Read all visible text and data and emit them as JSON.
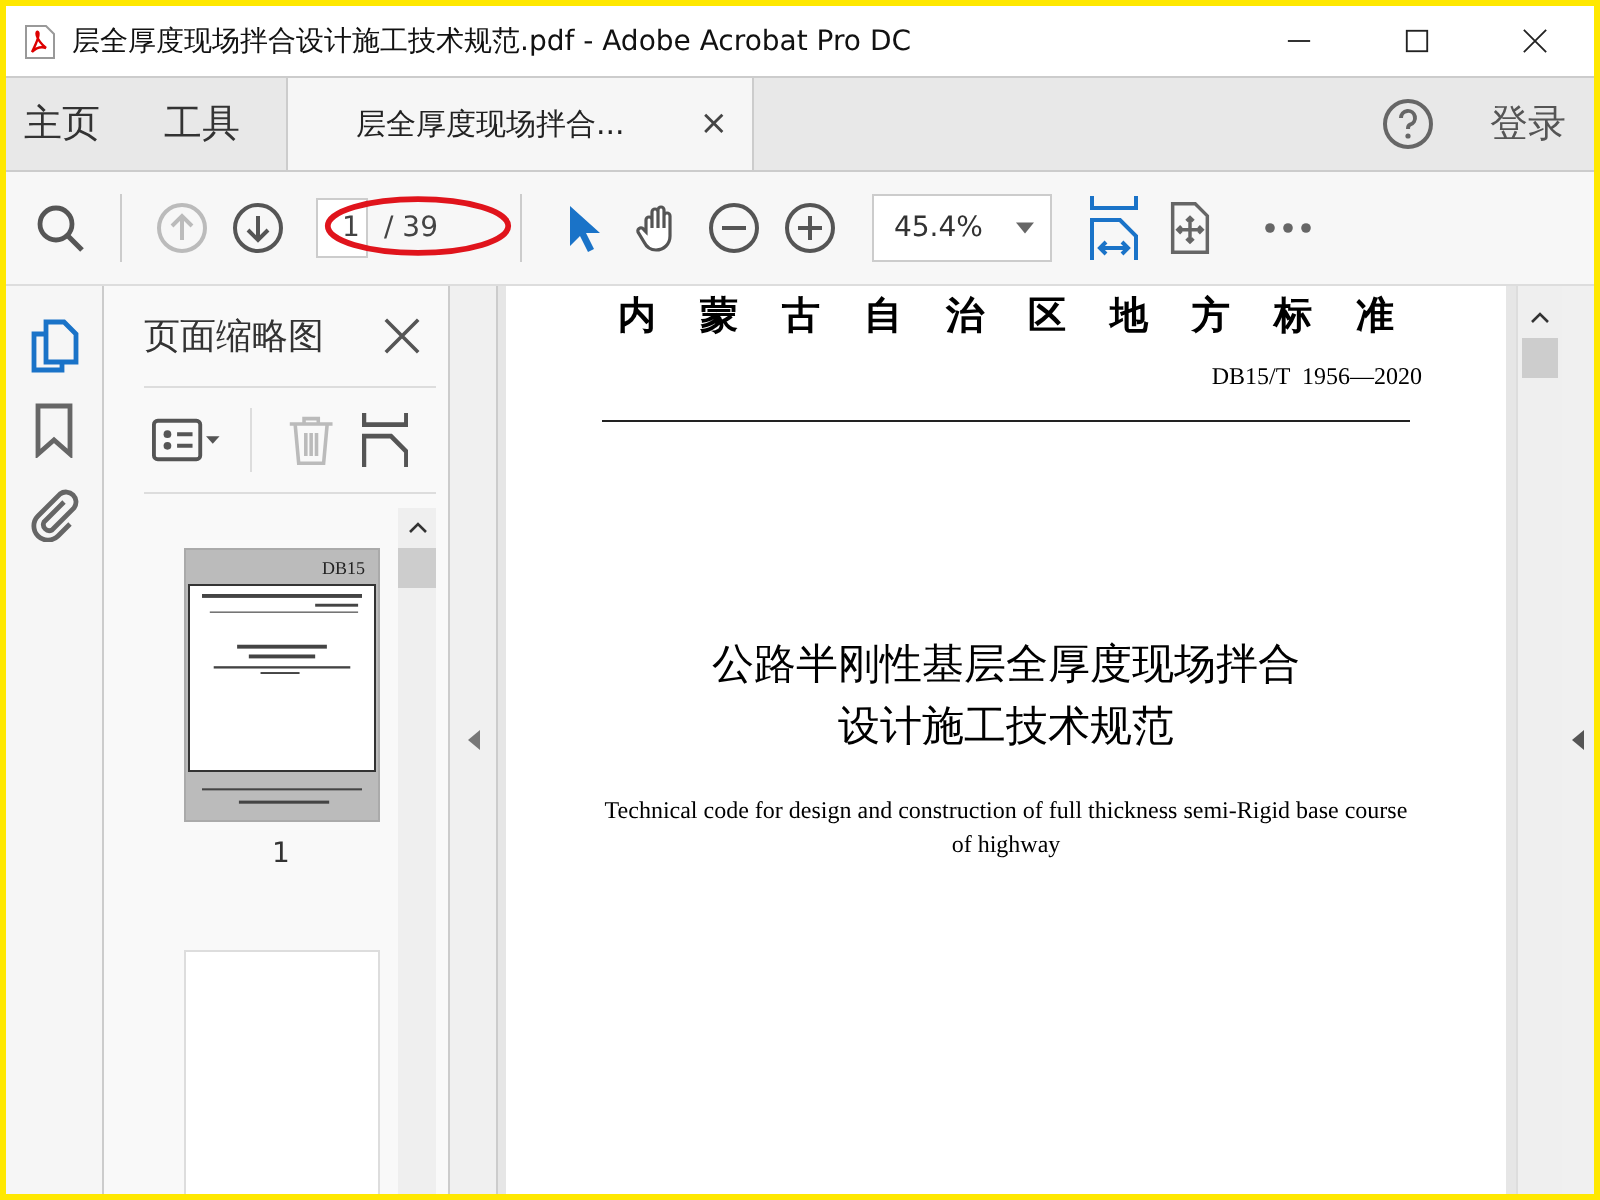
{
  "window": {
    "title": "层全厚度现场拌合设计施工技术规范.pdf - Adobe Acrobat Pro DC"
  },
  "nav": [
    {
      "label": "主页"
    },
    {
      "label": "工具"
    }
  ],
  "tabs": [
    {
      "label": "层全厚度现场拌合...",
      "selected": true,
      "close": "×"
    }
  ],
  "account": {
    "login": "登录"
  },
  "toolbar": {
    "prev_disabled": true,
    "page_value": "1",
    "page_total": "/ 39",
    "zoom": "45.4%"
  },
  "rail": [
    {
      "kind": "pages",
      "selected": true
    },
    {
      "kind": "bookmark",
      "selected": false
    },
    {
      "kind": "attachment",
      "selected": false
    }
  ],
  "sidebar": {
    "title": "页面缩略图",
    "thumbnails": [
      {
        "selected": true,
        "cover": "DB15",
        "label": "1"
      },
      {
        "selected": false
      }
    ]
  },
  "document": {
    "header": "内蒙古自治区地方标准",
    "code": "DB15/T  1956—2020",
    "title_lines": [
      "公路半刚性基层全厚度现场拌合",
      "设计施工技术规范"
    ],
    "english": "Technical code for design and construction of full thickness semi-Rigid base course of highway"
  }
}
